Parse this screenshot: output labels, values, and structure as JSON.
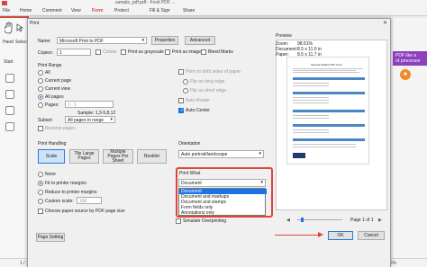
{
  "app": {
    "title": "sample_pdf.pdf - Foxit PDF ...",
    "ribbon_tabs": [
      "File",
      "Home",
      "Comment",
      "View",
      "Form",
      "Protect",
      "Fill & Sign",
      "Share"
    ],
    "active_tab": "Form",
    "left": {
      "hand": "Hand",
      "select": "Select",
      "start": "Start"
    },
    "promo": "PDF like a\nrd processor",
    "status": {
      "page": "1 / 1",
      "zoom": "95.16%"
    }
  },
  "dialog": {
    "title": "Print",
    "name_label": "Name:",
    "printer": "Microsoft Print to PDF",
    "properties_btn": "Properties",
    "advanced_btn": "Advanced",
    "copies_label": "Copies:",
    "copies_value": "1",
    "collate": "Collate",
    "print_grayscale": "Print as grayscale",
    "print_as_image": "Print as image",
    "bleed_marks": "Bleed Marks",
    "print_range": {
      "title": "Print Range",
      "all": "All",
      "current_page": "Current page",
      "current_view": "Current view",
      "all_pages": "All pages",
      "pages": "Pages:",
      "pages_value": "1 - 1",
      "sample": "Sample: 1,3-5,8,12",
      "subset_label": "Subset:",
      "subset_value": "All pages in range",
      "reverse": "Reverse pages"
    },
    "duplex": {
      "both_sides": "Print on both sides of paper",
      "long_edge": "Flip on long edge",
      "short_edge": "Flip on short edge",
      "auto_rotate": "Auto-Rotate",
      "auto_center": "Auto-Center"
    },
    "handling": {
      "title": "Print Handling",
      "modes": [
        "Scale",
        "Tile Large Pages",
        "Multiple Pages Per Sheet",
        "Booklet"
      ],
      "none": "None",
      "fit": "Fit to printer margins",
      "reduce": "Reduce to printer margins",
      "custom": "Custom scale:",
      "custom_value": "100",
      "choose_source": "Choose paper source by PDF page size"
    },
    "orientation": {
      "title": "Orientation",
      "value": "Auto portrait/landscape"
    },
    "print_what": {
      "title": "Print What",
      "selected": "Document",
      "options": [
        "Document",
        "Document and markups",
        "Document and stamps",
        "Form fields only",
        "Annotations only"
      ]
    },
    "simulate": "Simulate Overprinting",
    "page_setting": "Page Setting",
    "preview": {
      "title": "Preview",
      "zoom_label": "Zoom:",
      "zoom_value": "98.61%",
      "doc_label": "Document:",
      "doc_value": "8.5 x 11.0 in",
      "paper_label": "Paper:",
      "paper_value": "8.5 x 11.7 in",
      "page_title": "Sample Fillable PDF Form",
      "page_counter": "Page 1 of 1"
    },
    "ok": "OK",
    "cancel": "Cancel"
  },
  "colors": {
    "accent": "#1a73e8",
    "highlight": "#e0443a",
    "brand": "#d14a3b"
  }
}
